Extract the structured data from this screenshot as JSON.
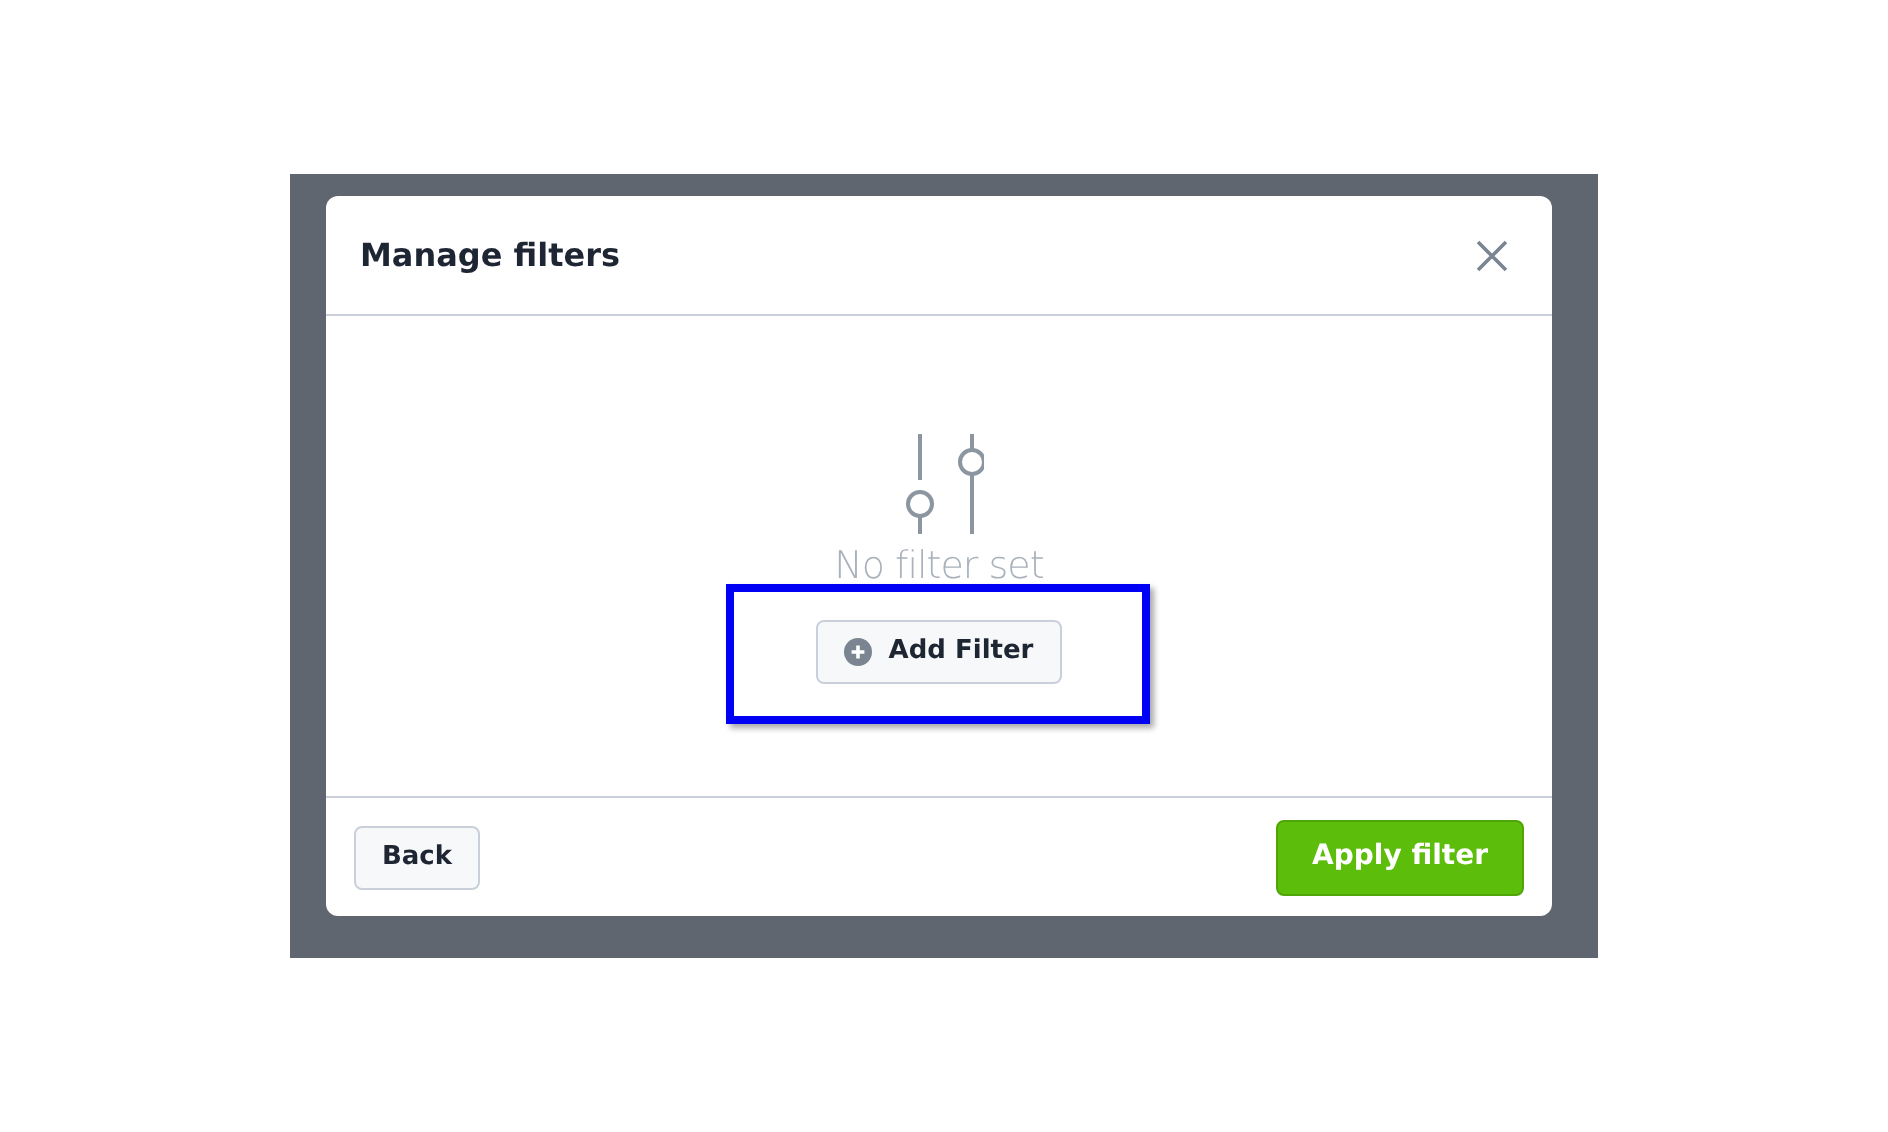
{
  "dialog": {
    "title": "Manage filters"
  },
  "empty_state": {
    "message": "No filter set"
  },
  "add_filter": {
    "label": "Add Filter",
    "highlighted": true
  },
  "footer": {
    "back": "Back",
    "apply": "Apply filter"
  }
}
